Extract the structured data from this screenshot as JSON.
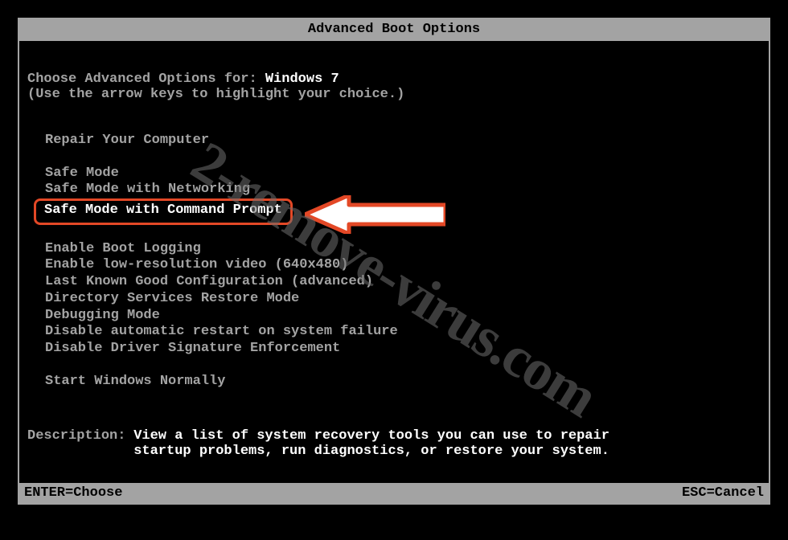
{
  "title": "Advanced Boot Options",
  "prompt": {
    "prefix": "Choose Advanced Options for: ",
    "os": "Windows 7",
    "hint": "(Use the arrow keys to highlight your choice.)"
  },
  "menu": {
    "group1": [
      "Repair Your Computer"
    ],
    "group2": [
      "Safe Mode",
      "Safe Mode with Networking",
      "Safe Mode with Command Prompt"
    ],
    "group3": [
      "Enable Boot Logging",
      "Enable low-resolution video (640x480)",
      "Last Known Good Configuration (advanced)",
      "Directory Services Restore Mode",
      "Debugging Mode",
      "Disable automatic restart on system failure",
      "Disable Driver Signature Enforcement"
    ],
    "group4": [
      "Start Windows Normally"
    ],
    "highlighted_index": 2
  },
  "description": {
    "label": "Description:",
    "text": "View a list of system recovery tools you can use to repair startup problems, run diagnostics, or restore your system."
  },
  "footer": {
    "left": "ENTER=Choose",
    "right": "ESC=Cancel"
  },
  "annotation": {
    "arrow_color": "#e34826",
    "arrow_fill": "#ffffff"
  },
  "watermark": "2-remove-virus.com"
}
